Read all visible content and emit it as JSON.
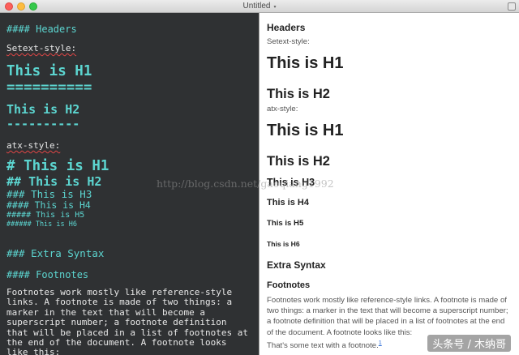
{
  "window": {
    "title": "Untitled",
    "title_caret": "▾"
  },
  "editor": {
    "headers_heading": "#### Headers",
    "setext_label": "Setext-style:",
    "setext_h1": "This is H1",
    "setext_h1_underline": "==========",
    "setext_h2": "This is H2",
    "setext_h2_underline": "----------",
    "atx_label": "atx-style:",
    "atx_h1": "# This is H1",
    "atx_h2": "## This is H2",
    "atx_h3": "### This is H3",
    "atx_h4": "#### This is H4",
    "atx_h5": "##### This is H5",
    "atx_h6": "###### This is H6",
    "extra_syntax": "### Extra Syntax",
    "footnotes_heading": "#### Footnotes",
    "footnotes_paragraph": "Footnotes work mostly like reference-style links. A footnote is made of two things: a marker in the text that will become a superscript number; a footnote definition that will be placed in a list of footnotes at the end of the document. A footnote looks like this:"
  },
  "preview": {
    "headers": "Headers",
    "setext_label": "Setext-style:",
    "setext_h1": "This is H1",
    "setext_h2": "This is H2",
    "atx_label": "atx-style:",
    "atx_h1": "This is H1",
    "atx_h2": "This is H2",
    "atx_h3": "This is H3",
    "atx_h4": "This is H4",
    "atx_h5": "This is H5",
    "atx_h6": "This is H6",
    "extra_syntax": "Extra Syntax",
    "footnotes": "Footnotes",
    "footnotes_paragraph": "Footnotes work mostly like reference-style links. A footnote is made of two things: a marker in the text that will become a superscript number; a footnote definition that will be placed in a list of footnotes at the end of the document. A footnote looks like this:",
    "footnote_example": "That's some text with a footnote.",
    "footnote_marker": "1"
  },
  "overlay": {
    "watermark": "http://blog.csdn.net/gaoqiang1992",
    "brand": "头条号 / 木纳哥"
  },
  "colors": {
    "editor_bg": "#2f3133",
    "editor_heading": "#5cd5d0",
    "editor_text": "#e8e8e8",
    "close": "#fc605c",
    "minimize": "#fdbc40",
    "maximize": "#34c84a"
  }
}
